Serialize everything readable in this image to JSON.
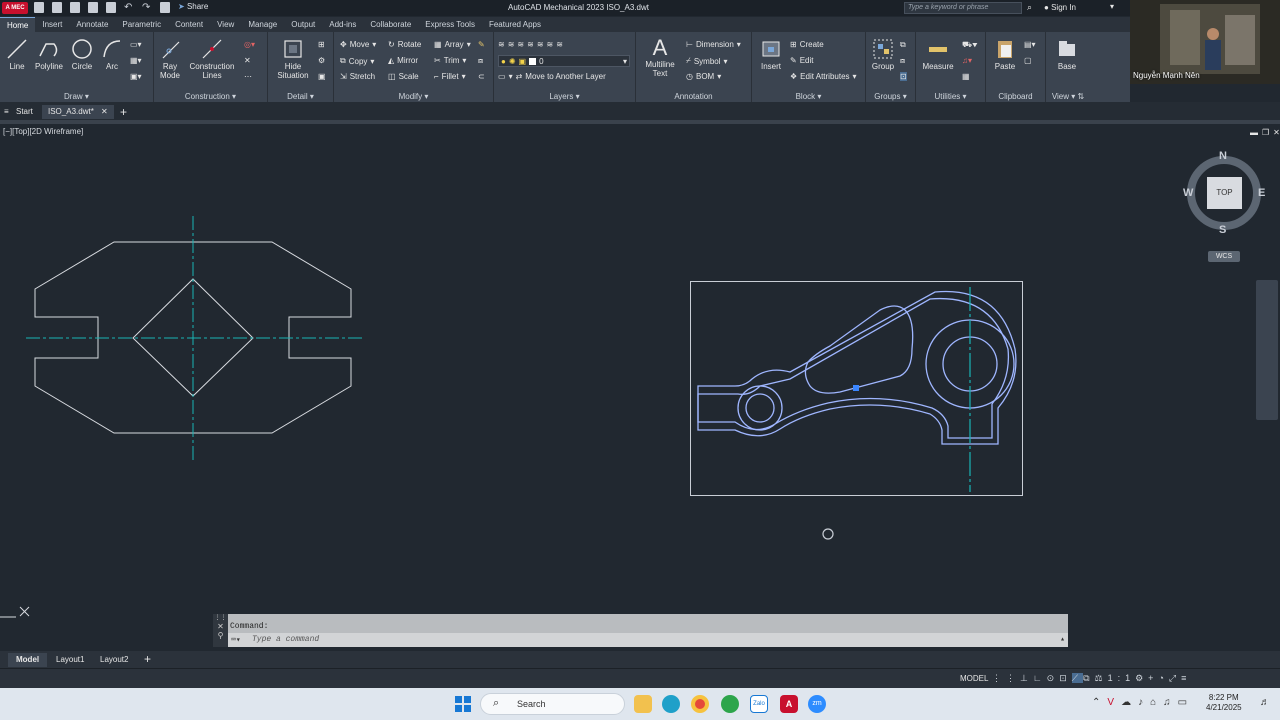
{
  "app": {
    "logo_text": "A MEC",
    "title": "AutoCAD Mechanical 2023    ISO_A3.dwt",
    "share_label": "Share",
    "search_placeholder": "Type a keyword or phrase",
    "signin_label": "Sign In"
  },
  "ribbon_tabs": [
    "Home",
    "Insert",
    "Annotate",
    "Parametric",
    "Content",
    "View",
    "Manage",
    "Output",
    "Add-ins",
    "Collaborate",
    "Express Tools",
    "Featured Apps"
  ],
  "panels": {
    "draw": {
      "title": "Draw",
      "buttons": [
        "Line",
        "Polyline",
        "Circle",
        "Arc"
      ]
    },
    "construction": {
      "title": "Construction",
      "buttons": [
        "Ray Mode",
        "Construction Lines"
      ]
    },
    "detail": {
      "title": "Detail",
      "buttons": [
        "Hide Situation"
      ]
    },
    "modify": {
      "title": "Modify",
      "items": [
        "Move",
        "Rotate",
        "Array",
        "Copy",
        "Mirror",
        "Trim",
        "Stretch",
        "Scale",
        "Fillet"
      ]
    },
    "layers": {
      "title": "Layers",
      "current_layer": "0",
      "move_label": "Move to Another Layer"
    },
    "annotation": {
      "title": "Annotation",
      "big": "Multiline Text",
      "items": [
        "Dimension",
        "Symbol",
        "BOM"
      ]
    },
    "block": {
      "title": "Block",
      "big": "Insert",
      "items": [
        "Create",
        "Edit",
        "Edit Attributes"
      ]
    },
    "groups": {
      "title": "Groups",
      "big": "Group"
    },
    "utilities": {
      "title": "Utilities",
      "big": "Measure"
    },
    "clipboard": {
      "title": "Clipboard",
      "big": "Paste"
    },
    "view": {
      "title": "View",
      "big": "Base"
    }
  },
  "file_tabs": {
    "start": "Start",
    "active": "ISO_A3.dwt*"
  },
  "viewport_label": "[−][Top][2D Wireframe]",
  "viewcube": {
    "top": "TOP",
    "n": "N",
    "s": "S",
    "e": "E",
    "w": "W",
    "wcs": "WCS"
  },
  "command": {
    "history": "Command:",
    "placeholder": "Type a command"
  },
  "layout_tabs": [
    "Model",
    "Layout1",
    "Layout2"
  ],
  "status": {
    "model": "MODEL"
  },
  "taskbar": {
    "search": "Search",
    "time": "8:22 PM",
    "date": "4/21/2025"
  },
  "webcam": {
    "name": "Nguyễn Mạnh Nên"
  },
  "colors": {
    "accent": "#7aa7d9",
    "centerline": "#19b5b5",
    "geometry": "#d8dbe0",
    "selected": "#9fb6ff"
  }
}
